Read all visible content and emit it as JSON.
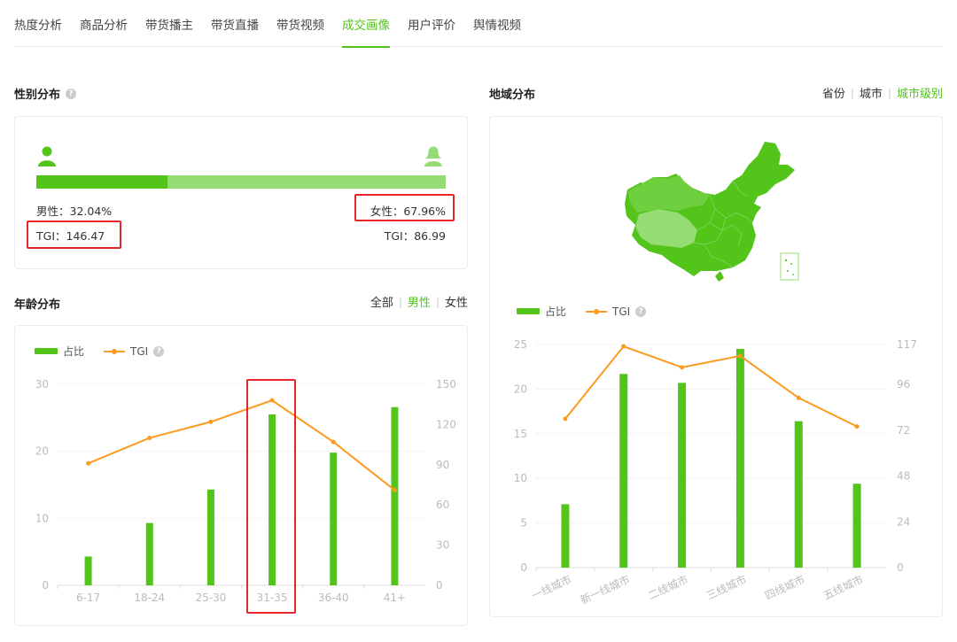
{
  "tabs": [
    {
      "label": "热度分析",
      "active": false
    },
    {
      "label": "商品分析",
      "active": false
    },
    {
      "label": "带货播主",
      "active": false
    },
    {
      "label": "带货直播",
      "active": false
    },
    {
      "label": "带货视频",
      "active": false
    },
    {
      "label": "成交画像",
      "active": true
    },
    {
      "label": "用户评价",
      "active": false
    },
    {
      "label": "舆情视频",
      "active": false
    }
  ],
  "gender": {
    "title": "性别分布",
    "male_label": "男性：32.04%",
    "female_label": "女性：67.96%",
    "male_tgi": "TGI：146.47",
    "female_tgi": "TGI：86.99",
    "male_share": 0.3204,
    "male_icon": "male-user-icon",
    "female_icon": "female-user-icon"
  },
  "age": {
    "title": "年龄分布",
    "filters": [
      {
        "label": "全部",
        "active": false
      },
      {
        "label": "男性",
        "active": true
      },
      {
        "label": "女性",
        "active": false
      }
    ],
    "legend_bar": "占比",
    "legend_line": "TGI"
  },
  "region": {
    "title": "地域分布",
    "filters": [
      {
        "label": "省份",
        "active": false
      },
      {
        "label": "城市",
        "active": false
      },
      {
        "label": "城市级别",
        "active": true
      }
    ],
    "legend_bar": "占比",
    "legend_line": "TGI",
    "map_icon": "china-map-icon"
  },
  "colors": {
    "accent": "#52c41a",
    "accent_light": "#95dc74",
    "line": "#fa9b1f",
    "highlight": "#e6262b"
  },
  "chart_data": [
    {
      "type": "bar",
      "categories": [
        "6-17",
        "18-24",
        "25-30",
        "31-35",
        "36-40",
        "41+"
      ],
      "series": [
        {
          "name": "占比",
          "axis": "left",
          "values": [
            4.3,
            9.3,
            14.3,
            25.5,
            19.8,
            26.6
          ]
        },
        {
          "name": "TGI",
          "axis": "right",
          "type": "line",
          "values": [
            91,
            110,
            122,
            138,
            107,
            71
          ]
        }
      ],
      "ylim": [
        0,
        30
      ],
      "yticks": [
        0,
        10,
        20,
        30
      ],
      "y2lim": [
        0,
        150
      ],
      "y2ticks": [
        0,
        30,
        60,
        90,
        120,
        150
      ],
      "highlight_category": "31-35",
      "grid": true,
      "legend": "top-left"
    },
    {
      "type": "bar",
      "categories": [
        "一线城市",
        "新一线城市",
        "二线城市",
        "三线城市",
        "四线城市",
        "五线城市"
      ],
      "series": [
        {
          "name": "占比",
          "axis": "left",
          "values": [
            7.1,
            21.7,
            20.7,
            24.5,
            16.4,
            9.4
          ]
        },
        {
          "name": "TGI",
          "axis": "right",
          "type": "line",
          "values": [
            78,
            116,
            105,
            111,
            89,
            74
          ]
        }
      ],
      "ylim": [
        0,
        25
      ],
      "yticks": [
        0,
        5,
        10,
        15,
        20,
        25
      ],
      "y2lim": [
        0,
        117
      ],
      "y2ticks": [
        0,
        24,
        48,
        72,
        96,
        117
      ],
      "grid": true,
      "legend": "top-left"
    }
  ]
}
